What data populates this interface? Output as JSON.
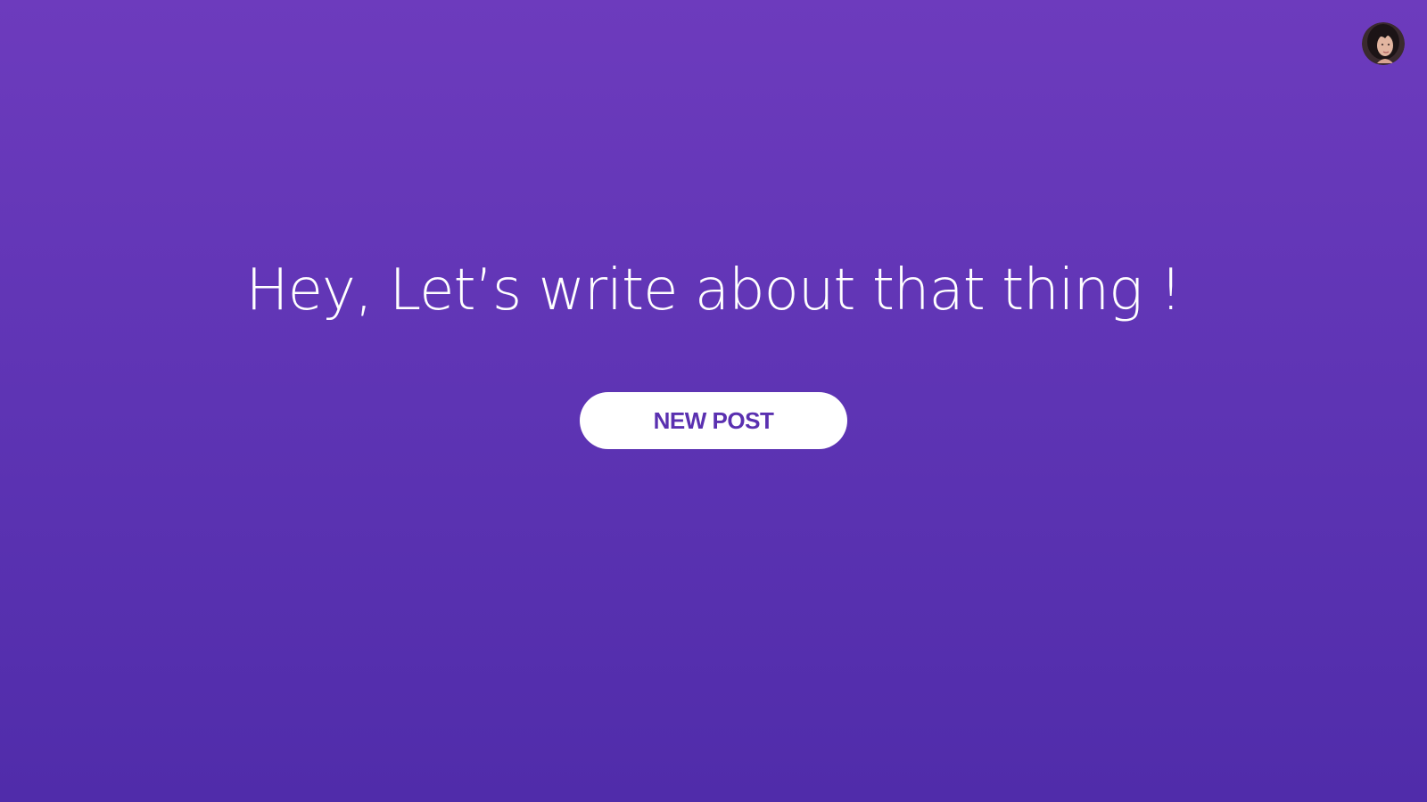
{
  "page": {
    "background_top": "#6d3bbd",
    "background_bottom": "#502caa"
  },
  "header": {
    "avatar_icon": "user-avatar-icon"
  },
  "main": {
    "headline": "Hey, Let’s write about that thing !",
    "new_post_label": "NEW POST",
    "button_text_color": "#5a30b0"
  }
}
